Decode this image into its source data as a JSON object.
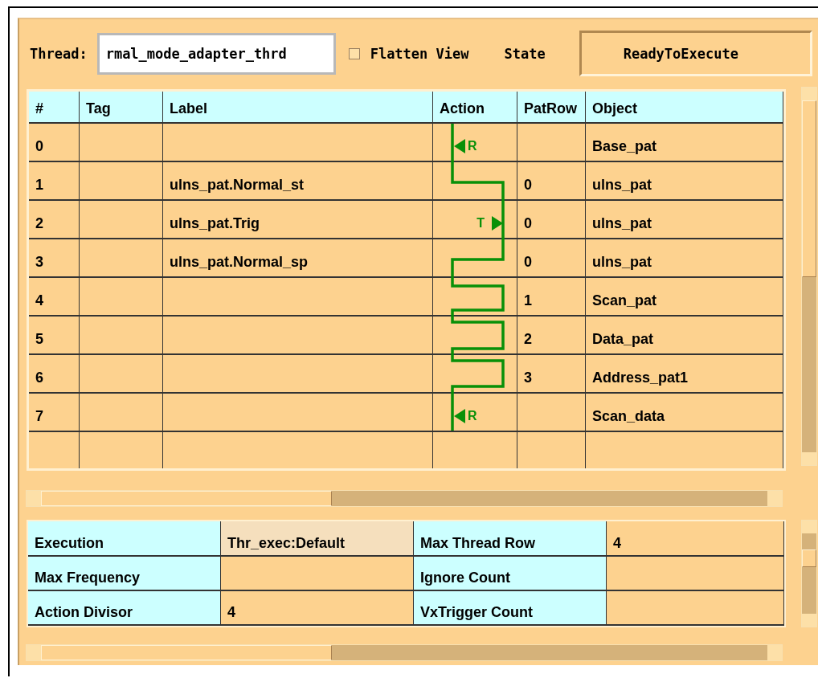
{
  "thread": {
    "label": "Thread:",
    "value": "rmal_mode_adapter_thrd"
  },
  "flatten_view": {
    "label": "Flatten View",
    "checked": false
  },
  "state": {
    "label": "State",
    "value": "ReadyToExecute"
  },
  "table": {
    "columns": [
      "#",
      "Tag",
      "Label",
      "Action",
      "PatRow",
      "Object"
    ],
    "rows": [
      {
        "num": "0",
        "object": "Base_pat",
        "action": {
          "kind": "return",
          "label": "R"
        }
      },
      {
        "num": "1",
        "label": "ulns_pat.Normal_st",
        "patrow": "0",
        "object": "ulns_pat"
      },
      {
        "num": "2",
        "label": "ulns_pat.Trig",
        "patrow": "0",
        "object": "ulns_pat",
        "action": {
          "kind": "trigger",
          "label": "T"
        }
      },
      {
        "num": "3",
        "label": "ulns_pat.Normal_sp",
        "patrow": "0",
        "object": "ulns_pat"
      },
      {
        "num": "4",
        "patrow": "1",
        "object": "Scan_pat"
      },
      {
        "num": "5",
        "patrow": "2",
        "object": "Data_pat"
      },
      {
        "num": "6",
        "patrow": "3",
        "object": "Address_pat1"
      },
      {
        "num": "7",
        "object": "Scan_data",
        "action": {
          "kind": "return",
          "label": "R"
        }
      }
    ]
  },
  "properties": [
    [
      {
        "label": "Execution",
        "value": "Thr_exec:Default",
        "selected": true
      },
      {
        "label": "Max Thread Row",
        "value": "4",
        "selected": false
      }
    ],
    [
      {
        "label": "Max Frequency",
        "selected": false
      },
      {
        "label": "Ignore Count",
        "selected": false
      }
    ],
    [
      {
        "label": "Action Divisor",
        "value": "4",
        "selected": false
      },
      {
        "label": "VxTrigger Count",
        "selected": false
      }
    ]
  ]
}
